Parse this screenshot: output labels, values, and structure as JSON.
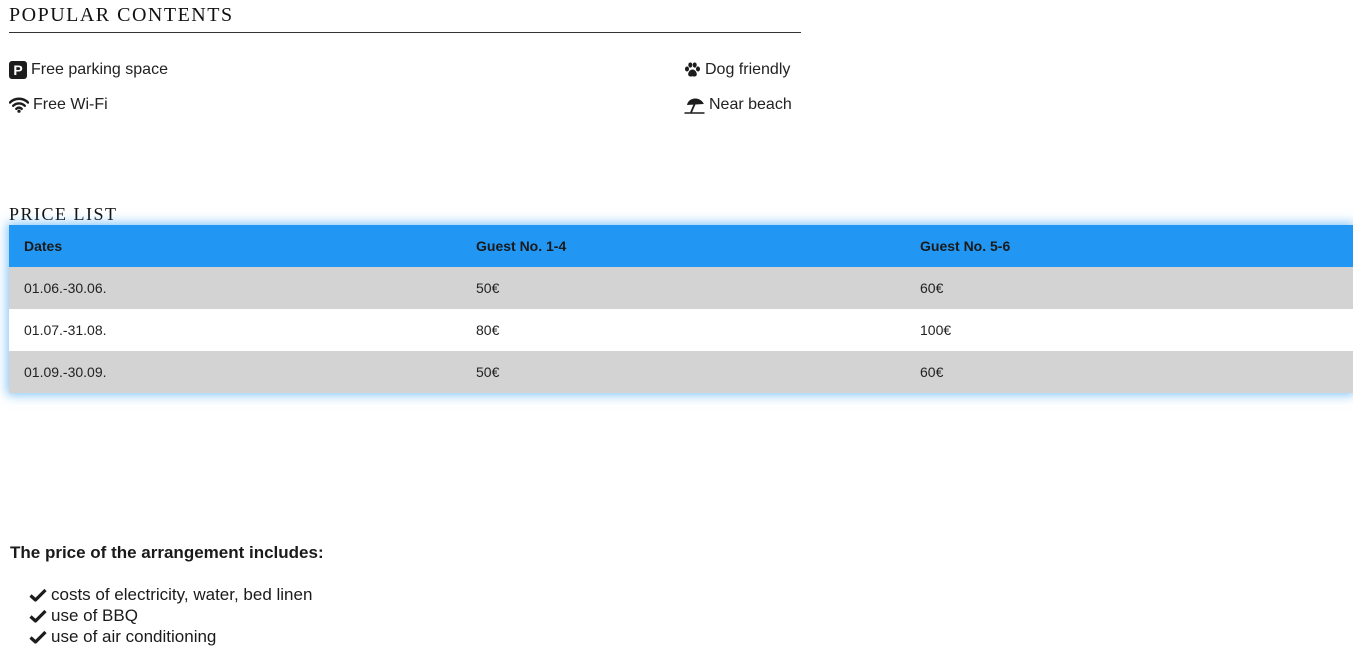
{
  "popular": {
    "title": "POPULAR CONTENTS",
    "amenities": [
      {
        "label": "Free parking space",
        "icon": "parking-icon"
      },
      {
        "label": "Dog friendly",
        "icon": "paw-icon"
      },
      {
        "label": "Free Wi-Fi",
        "icon": "wifi-icon"
      },
      {
        "label": "Near beach",
        "icon": "umbrella-beach-icon"
      }
    ],
    "parking_letter": "P"
  },
  "price_list": {
    "title": "PRICE LIST",
    "headers": [
      "Dates",
      "Guest No. 1-4",
      "Guest No. 5-6"
    ],
    "rows": [
      [
        "01.06.-30.06.",
        "50€",
        "60€"
      ],
      [
        "01.07.-31.08.",
        "80€",
        "100€"
      ],
      [
        "01.09.-30.09.",
        "50€",
        "60€"
      ]
    ],
    "colors": {
      "header_bg": "#2196f3",
      "odd_row_bg": "#d3d3d3",
      "even_row_bg": "#ffffff"
    }
  },
  "includes": {
    "title": "The price of the arrangement includes:",
    "items": [
      "costs of electricity, water, bed linen",
      "use of BBQ",
      "use of air conditioning"
    ],
    "icon": "check-icon"
  }
}
